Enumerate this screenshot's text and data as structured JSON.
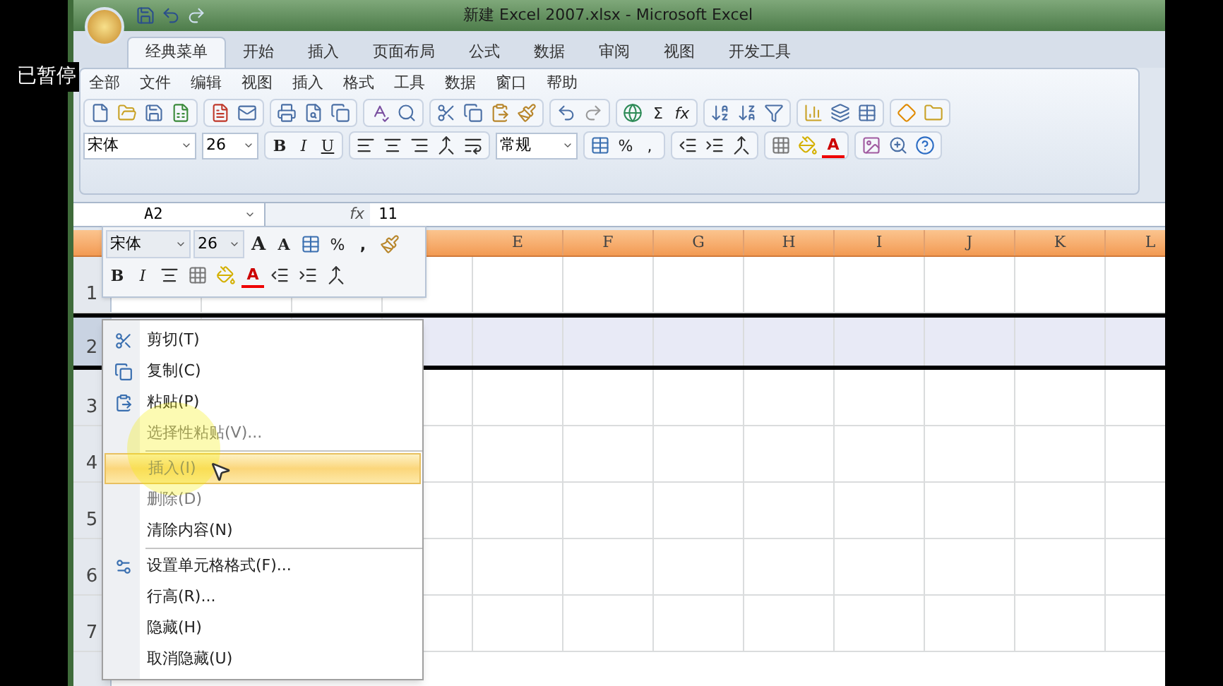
{
  "overlay_label": "已暂停",
  "title_bar": {
    "title": "新建 Excel 2007.xlsx - Microsoft Excel"
  },
  "ribbon_tabs": [
    {
      "label": "经典菜单",
      "selected": true
    },
    {
      "label": "开始",
      "selected": false
    },
    {
      "label": "插入",
      "selected": false
    },
    {
      "label": "页面布局",
      "selected": false
    },
    {
      "label": "公式",
      "selected": false
    },
    {
      "label": "数据",
      "selected": false
    },
    {
      "label": "审阅",
      "selected": false
    },
    {
      "label": "视图",
      "selected": false
    },
    {
      "label": "开发工具",
      "selected": false
    }
  ],
  "menu_bar": [
    "全部",
    "文件",
    "编辑",
    "视图",
    "插入",
    "格式",
    "工具",
    "数据",
    "窗口",
    "帮助"
  ],
  "toolbar": {
    "sum": "Σ",
    "fx": "fx",
    "font": "宋体",
    "font_size": "26",
    "bold": "B",
    "italic": "I",
    "underline": "U",
    "number_format": "常规",
    "percent": "%",
    "comma": ",",
    "font_color": "A"
  },
  "formula_bar": {
    "name_box": "A2",
    "fx": "fx",
    "value": "11"
  },
  "mini_toolbar": {
    "font": "宋体",
    "font_size": "26",
    "grow": "A",
    "shrink": "A",
    "percent": "%",
    "comma": ",",
    "bold": "B",
    "italic": "I",
    "font_color": "A"
  },
  "sheet": {
    "columns": [
      "E",
      "F",
      "G",
      "H",
      "I",
      "J",
      "K",
      "L"
    ],
    "rows": [
      {
        "label": "1",
        "selected": false
      },
      {
        "label": "2",
        "selected": true
      },
      {
        "label": "3",
        "selected": false
      },
      {
        "label": "4",
        "selected": false
      },
      {
        "label": "5",
        "selected": false
      },
      {
        "label": "6",
        "selected": false
      },
      {
        "label": "7",
        "selected": false
      }
    ]
  },
  "context_menu": [
    {
      "label": "剪切(T)",
      "disabled": false,
      "selected": false,
      "separator_before": false
    },
    {
      "label": "复制(C)",
      "disabled": false,
      "selected": false,
      "separator_before": false
    },
    {
      "label": "粘贴(P)",
      "disabled": false,
      "selected": false,
      "separator_before": false
    },
    {
      "label": "选择性粘贴(V)...",
      "disabled": true,
      "selected": false,
      "separator_before": false
    },
    {
      "label": "插入(I)",
      "disabled": true,
      "selected": true,
      "separator_before": true
    },
    {
      "label": "删除(D)",
      "disabled": true,
      "selected": false,
      "separator_before": false
    },
    {
      "label": "清除内容(N)",
      "disabled": false,
      "selected": false,
      "separator_before": false
    },
    {
      "label": "设置单元格格式(F)...",
      "disabled": false,
      "selected": false,
      "separator_before": true
    },
    {
      "label": "行高(R)...",
      "disabled": false,
      "selected": false,
      "separator_before": false
    },
    {
      "label": "隐藏(H)",
      "disabled": false,
      "selected": false,
      "separator_before": false
    },
    {
      "label": "取消隐藏(U)",
      "disabled": false,
      "selected": false,
      "separator_before": false
    }
  ]
}
